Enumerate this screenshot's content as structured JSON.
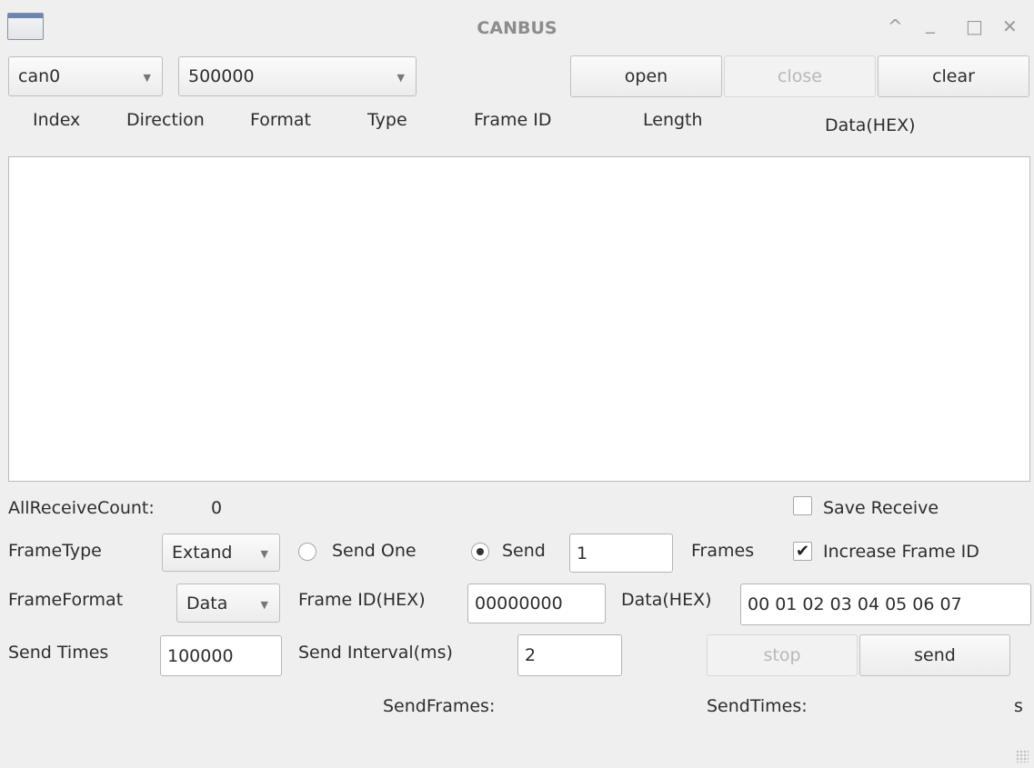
{
  "window": {
    "title": "CANBUS",
    "controls": {
      "up": "^",
      "minimize": "_",
      "maximize": "□",
      "close": "✕"
    }
  },
  "toolbar": {
    "device": "can0",
    "baudrate": "500000",
    "open_label": "open",
    "close_label": "close",
    "clear_label": "clear"
  },
  "table": {
    "columns": [
      "Index",
      "Direction",
      "Format",
      "Type",
      "Frame ID",
      "Length",
      "Data(HEX)"
    ],
    "rows": []
  },
  "status": {
    "all_receive_count_label": "AllReceiveCount:",
    "all_receive_count": "0",
    "save_receive_label": "Save Receive",
    "save_receive_checked": false
  },
  "send": {
    "frame_type_label": "FrameType",
    "frame_type": "Extand",
    "send_one_label": "Send One",
    "send_label": "Send",
    "send_mode": "send",
    "frames_value": "1",
    "frames_label": "Frames",
    "increase_id_label": "Increase Frame ID",
    "increase_id_checked": true,
    "frame_format_label": "FrameFormat",
    "frame_format": "Data",
    "frame_id_label": "Frame ID(HEX)",
    "frame_id": "00000000",
    "data_label": "Data(HEX)",
    "data": "00 01 02 03 04 05 06 07",
    "send_times_label": "Send Times",
    "send_times": "100000",
    "send_interval_label": "Send Interval(ms)",
    "send_interval": "2",
    "stop_label": "stop",
    "send_button_label": "send"
  },
  "footer": {
    "send_frames_label": "SendFrames:",
    "send_times_label": "SendTimes:",
    "seconds_unit": "s"
  },
  "colors": {
    "window_bg": "#efefef",
    "list_bg": "#ffffff",
    "disabled_text": "#b8b8b8",
    "title_text": "#8c8c8c"
  }
}
